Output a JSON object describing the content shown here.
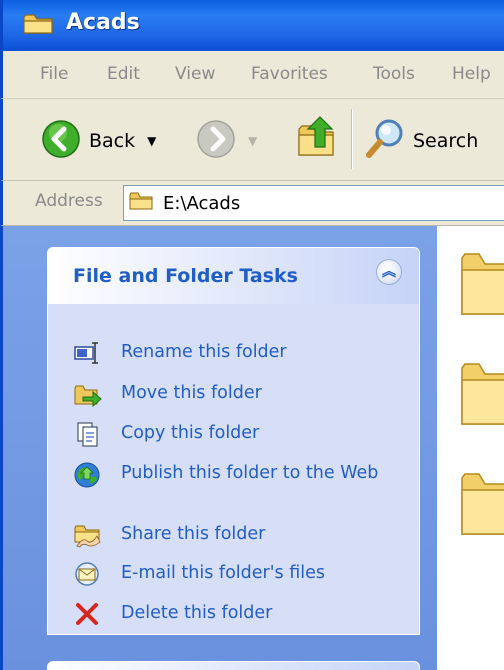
{
  "window": {
    "title": "Acads",
    "icon": "folder-icon"
  },
  "menu": {
    "items": [
      "File",
      "Edit",
      "View",
      "Favorites",
      "Tools",
      "Help"
    ]
  },
  "toolbar": {
    "back_label": "Back",
    "back_icon": "back-arrow-icon",
    "forward_icon": "forward-arrow-icon",
    "up_icon": "up-folder-icon",
    "search_label": "Search",
    "search_icon": "magnifier-icon"
  },
  "address": {
    "label": "Address",
    "value": "E:\\Acads"
  },
  "tasks_panel": {
    "title": "File and Folder Tasks",
    "items": [
      {
        "label": "Rename this folder",
        "icon": "rename-icon"
      },
      {
        "label": "Move this folder",
        "icon": "move-icon"
      },
      {
        "label": "Copy this folder",
        "icon": "copy-icon"
      },
      {
        "label": "Publish this folder to the Web",
        "icon": "publish-web-icon"
      },
      {
        "label": "Share this folder",
        "icon": "share-icon"
      },
      {
        "label": "E-mail this folder's files",
        "icon": "email-icon"
      },
      {
        "label": "Delete this folder",
        "icon": "delete-icon"
      }
    ]
  },
  "content": {
    "folders": 3
  },
  "colors": {
    "titlebar": "#1d66e6",
    "sidepane": "#7ba2e7",
    "task_link": "#215dc6",
    "chrome": "#ece9d8"
  }
}
